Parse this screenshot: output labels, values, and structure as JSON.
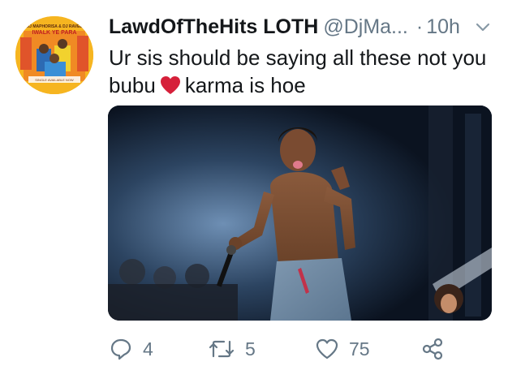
{
  "tweet": {
    "display_name": "LawdOfTheHits LOTH",
    "handle": "@DjMa...",
    "separator": "·",
    "time": "10h",
    "text_part1": "Ur sis should be saying all these not you bubu",
    "text_part2": "karma is hoe",
    "emoji": "red-heart"
  },
  "avatar_art": {
    "artist_line": "DJ MAPHORISA & DJ RAVEL",
    "title": "IWALK YE PARA",
    "bottom_line": "SINGLE AVAILABLE NOW"
  },
  "actions": {
    "reply_count": "4",
    "retweet_count": "5",
    "like_count": "75"
  },
  "colors": {
    "text": "#14171a",
    "secondary": "#657786",
    "heart": "#d6203a",
    "avatar_bg": "#f6b520"
  }
}
